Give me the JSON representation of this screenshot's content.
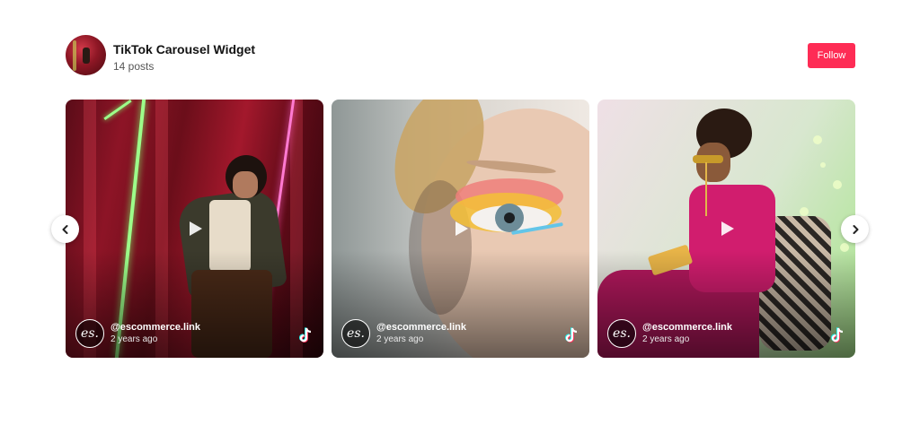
{
  "header": {
    "title": "TikTok Carousel Widget",
    "subtitle": "14 posts",
    "follow_label": "Follow"
  },
  "colors": {
    "follow_button": "#fe2c55",
    "background": "#ffffff"
  },
  "posts": [
    {
      "author_logo": "es.",
      "author": "@escommerce.link",
      "time": "2 years ago"
    },
    {
      "author_logo": "es.",
      "author": "@escommerce.link",
      "time": "2 years ago"
    },
    {
      "author_logo": "es.",
      "author": "@escommerce.link",
      "time": "2 years ago"
    }
  ],
  "icons": {
    "play": "play-icon",
    "platform": "tiktok-icon",
    "prev": "chevron-left-icon",
    "next": "chevron-right-icon"
  }
}
